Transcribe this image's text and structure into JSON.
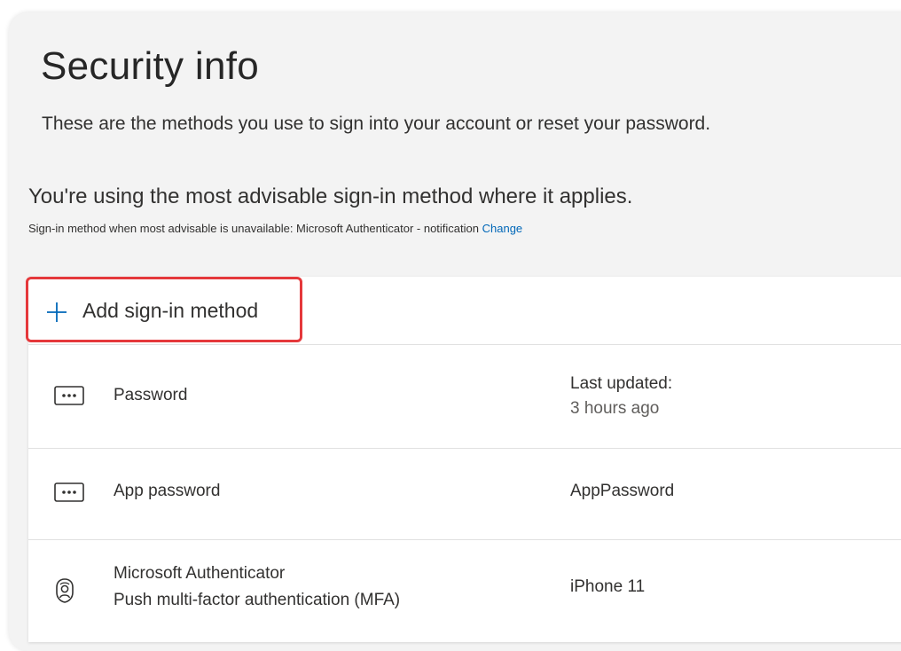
{
  "header": {
    "title": "Security info",
    "subtitle": "These are the methods you use to sign into your account or reset your password."
  },
  "advisory": {
    "headline": "You're using the most advisable sign-in method where it applies.",
    "fallback_text": "Sign-in method when most advisable is unavailable: Microsoft Authenticator - notification",
    "change_link": "Change"
  },
  "add_method": {
    "label": "Add sign-in method",
    "icon": "plus-icon"
  },
  "methods": [
    {
      "icon": "password-dots-icon",
      "name": "Password",
      "detail_label": "Last updated:",
      "detail_value": "3 hours ago"
    },
    {
      "icon": "password-dots-icon",
      "name": "App password",
      "detail_value": "AppPassword"
    },
    {
      "icon": "authenticator-icon",
      "name": "Microsoft Authenticator",
      "subtitle": "Push multi-factor authentication (MFA)",
      "detail_value": "iPhone 11"
    }
  ],
  "colors": {
    "accent_link": "#0067b8",
    "highlight_border": "#e5383b",
    "plus_icon": "#0067b8",
    "card_background": "#f3f3f3"
  }
}
